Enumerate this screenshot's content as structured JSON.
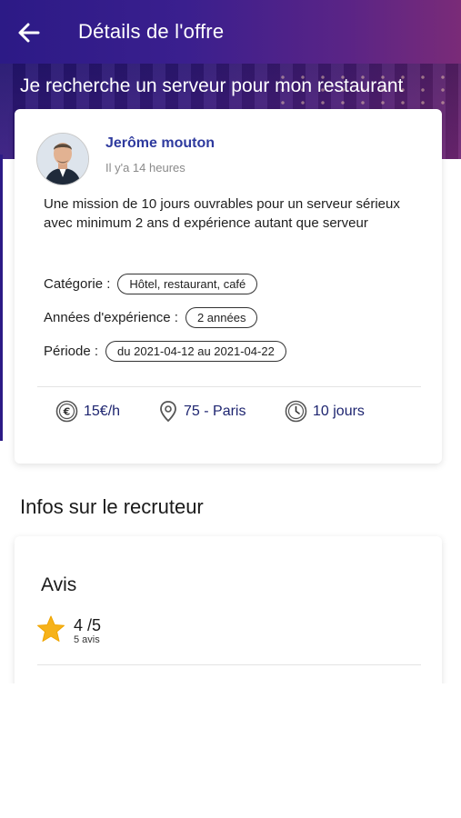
{
  "header": {
    "title": "Détails de l'offre"
  },
  "offer": {
    "title": "Je recherche un serveur pour mon restaurant",
    "poster_name": "Jerôme mouton",
    "posted_time": "Il y'a 14 heures",
    "description": "Une mission de 10 jours ouvrables pour un serveur sérieux avec minimum 2 ans d expérience autant que serveur",
    "category_label": "Catégorie :",
    "category_value": "Hôtel, restaurant, café",
    "experience_label": "Années d'expérience :",
    "experience_value": "2 années",
    "period_label": "Période :",
    "period_value": "du 2021-04-12 au 2021-04-22",
    "rate": "15€/h",
    "location": "75 - Paris",
    "duration": "10 jours"
  },
  "recruiter": {
    "section_title": "Infos sur le recruteur",
    "reviews_title": "Avis",
    "rating": "4 /5",
    "review_count": "5 avis"
  },
  "colors": {
    "header_start": "#2c1a86",
    "header_end": "#7a2b78",
    "accent": "#2e3a9e",
    "star": "#f6b21a"
  }
}
